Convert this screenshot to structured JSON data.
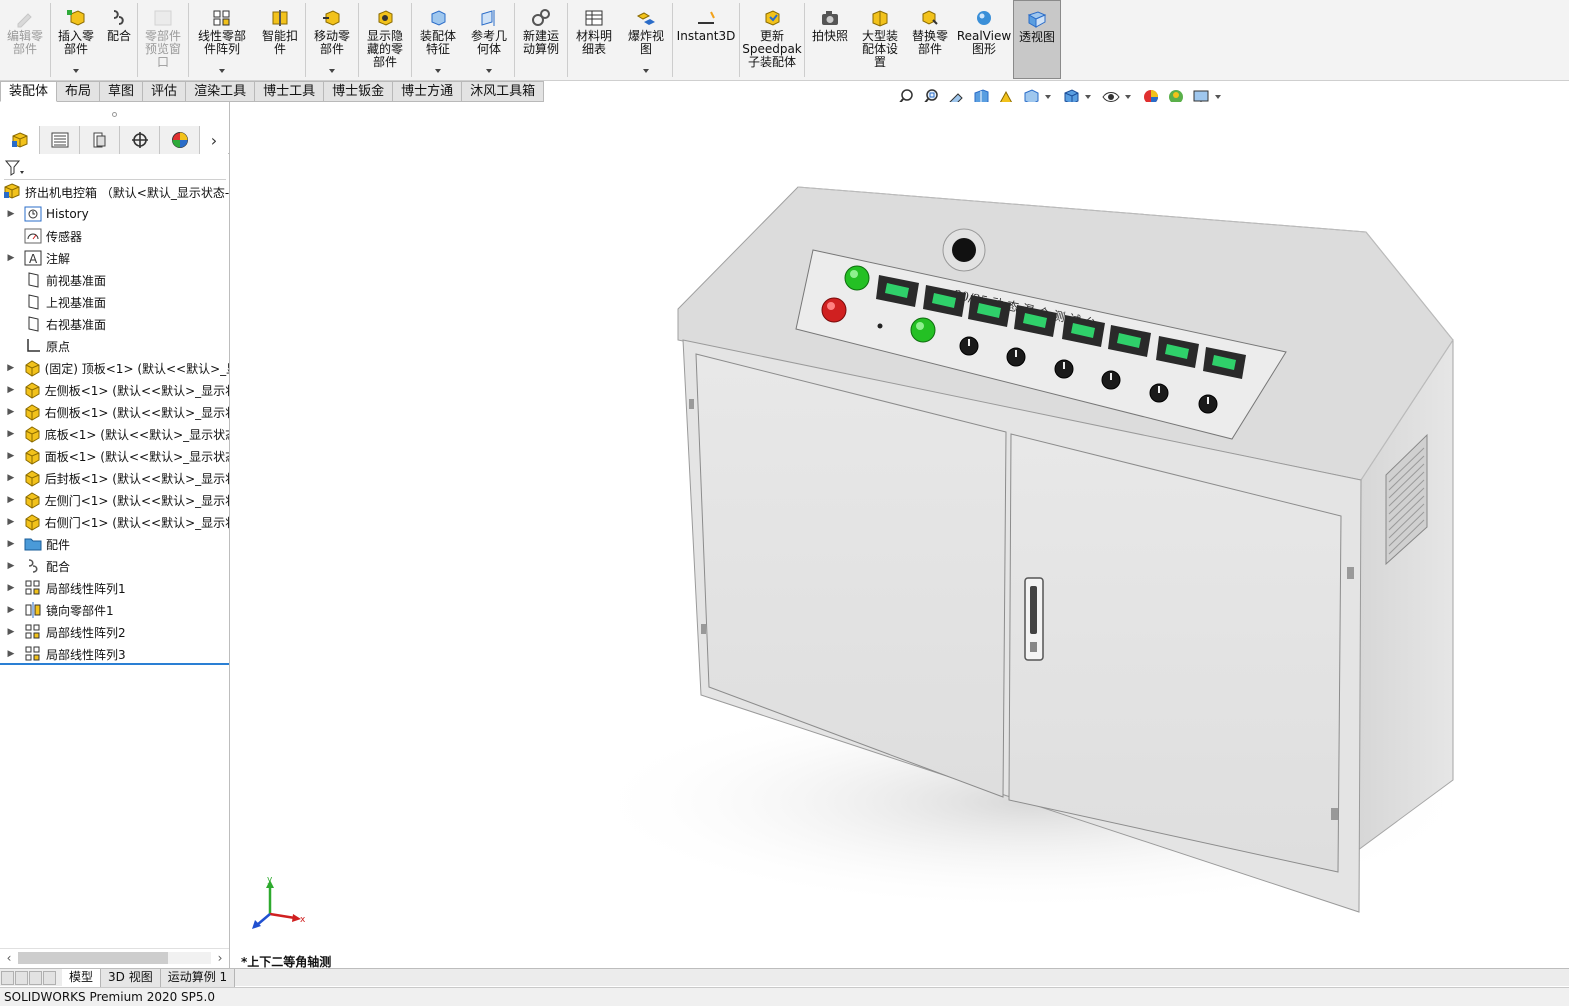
{
  "ribbon": [
    {
      "label": "编辑零\n部件",
      "icon": "edit-component-icon",
      "disabled": true,
      "dropdown": false
    },
    {
      "label": "插入零\n部件",
      "icon": "insert-component-icon",
      "disabled": false,
      "dropdown": true
    },
    {
      "label": "配合",
      "icon": "mate-icon",
      "disabled": false,
      "dropdown": false
    },
    {
      "label": "零部件\n预览窗\n口",
      "icon": "component-preview-icon",
      "disabled": true,
      "dropdown": false
    },
    {
      "label": "线性零部\n件阵列",
      "icon": "linear-pattern-icon",
      "disabled": false,
      "dropdown": true
    },
    {
      "label": "智能扣\n件",
      "icon": "smart-fasteners-icon",
      "disabled": false,
      "dropdown": false
    },
    {
      "label": "移动零\n部件",
      "icon": "move-component-icon",
      "disabled": false,
      "dropdown": true
    },
    {
      "label": "显示隐\n藏的零\n部件",
      "icon": "show-hidden-icon",
      "disabled": false,
      "dropdown": false
    },
    {
      "label": "装配体\n特征",
      "icon": "assembly-features-icon",
      "disabled": false,
      "dropdown": true
    },
    {
      "label": "参考几\n何体",
      "icon": "reference-geometry-icon",
      "disabled": false,
      "dropdown": true
    },
    {
      "label": "新建运\n动算例",
      "icon": "new-motion-study-icon",
      "disabled": false,
      "dropdown": false
    },
    {
      "label": "材料明\n细表",
      "icon": "bom-icon",
      "disabled": false,
      "dropdown": false
    },
    {
      "label": "爆炸视\n图",
      "icon": "exploded-view-icon",
      "disabled": false,
      "dropdown": true
    },
    {
      "label": "Instant3D",
      "icon": "instant3d-icon",
      "disabled": false,
      "dropdown": false
    },
    {
      "label": "更新\nSpeedpak\n子装配体",
      "icon": "speedpak-icon",
      "disabled": false,
      "dropdown": false
    },
    {
      "label": "拍快照",
      "icon": "snapshot-icon",
      "disabled": false,
      "dropdown": false
    },
    {
      "label": "大型装\n配体设\n置",
      "icon": "large-assembly-icon",
      "disabled": false,
      "dropdown": false
    },
    {
      "label": "替换零\n部件",
      "icon": "replace-components-icon",
      "disabled": false,
      "dropdown": false
    },
    {
      "label": "RealView\n图形",
      "icon": "realview-icon",
      "disabled": false,
      "dropdown": false
    },
    {
      "label": "透视图",
      "icon": "perspective-icon",
      "disabled": false,
      "dropdown": false,
      "active": true
    }
  ],
  "cm_tabs": [
    "装配体",
    "布局",
    "草图",
    "评估",
    "渲染工具",
    "博士工具",
    "博士钣金",
    "博士方通",
    "沐风工具箱"
  ],
  "hud_icons": [
    "zoom-to-fit-icon",
    "zoom-to-area-icon",
    "previous-view-icon",
    "section-view-icon",
    "dynamic-annotation-icon",
    "view-orientation-icon",
    "display-style-icon",
    "hide-show-icon",
    "edit-appearance-icon",
    "apply-scene-icon",
    "view-settings-icon"
  ],
  "tree": {
    "root": "挤出机电控箱 （默认<默认_显示状态-",
    "items": [
      {
        "label": "History",
        "icon": "history-icon",
        "expand": true
      },
      {
        "label": "传感器",
        "icon": "sensor-icon",
        "expand": false
      },
      {
        "label": "注解",
        "icon": "annotation-icon",
        "expand": true
      },
      {
        "label": "前视基准面",
        "icon": "plane-icon",
        "expand": false
      },
      {
        "label": "上视基准面",
        "icon": "plane-icon",
        "expand": false
      },
      {
        "label": "右视基准面",
        "icon": "plane-icon",
        "expand": false
      },
      {
        "label": "原点",
        "icon": "origin-icon",
        "expand": false
      },
      {
        "label": "(固定) 顶板<1> (默认<<默认>_显",
        "icon": "part-icon",
        "expand": true
      },
      {
        "label": "左侧板<1> (默认<<默认>_显示状",
        "icon": "part-icon",
        "expand": true
      },
      {
        "label": "右侧板<1> (默认<<默认>_显示状",
        "icon": "part-icon",
        "expand": true
      },
      {
        "label": "底板<1> (默认<<默认>_显示状态",
        "icon": "part-icon",
        "expand": true
      },
      {
        "label": "面板<1> (默认<<默认>_显示状态",
        "icon": "part-icon",
        "expand": true
      },
      {
        "label": "后封板<1> (默认<<默认>_显示状",
        "icon": "part-icon",
        "expand": true
      },
      {
        "label": "左侧门<1> (默认<<默认>_显示状",
        "icon": "part-icon",
        "expand": true
      },
      {
        "label": "右侧门<1> (默认<<默认>_显示状",
        "icon": "part-icon",
        "expand": true
      },
      {
        "label": "配件",
        "icon": "folder-icon",
        "expand": true
      },
      {
        "label": "配合",
        "icon": "mates-icon",
        "expand": true
      },
      {
        "label": "局部线性阵列1",
        "icon": "pattern-icon",
        "expand": true
      },
      {
        "label": "镜向零部件1",
        "icon": "mirror-icon",
        "expand": true
      },
      {
        "label": "局部线性阵列2",
        "icon": "pattern-icon",
        "expand": true
      },
      {
        "label": "局部线性阵列3",
        "icon": "pattern-icon",
        "expand": true
      }
    ]
  },
  "viewport": {
    "view_name": "*上下二等角轴测",
    "panel_title": "30/25 动 态 混 合 测 试 台",
    "triad": {
      "x": "x",
      "y": "y"
    }
  },
  "bottom_tabs": [
    "模型",
    "3D 视图",
    "运动算例 1"
  ],
  "status": "SOLIDWORKS Premium 2020 SP5.0",
  "colors": {
    "accent": "#2a7fd4",
    "green_button": "#25c025",
    "red_button": "#d01c1c",
    "cabinet": "#e6e6e6"
  }
}
